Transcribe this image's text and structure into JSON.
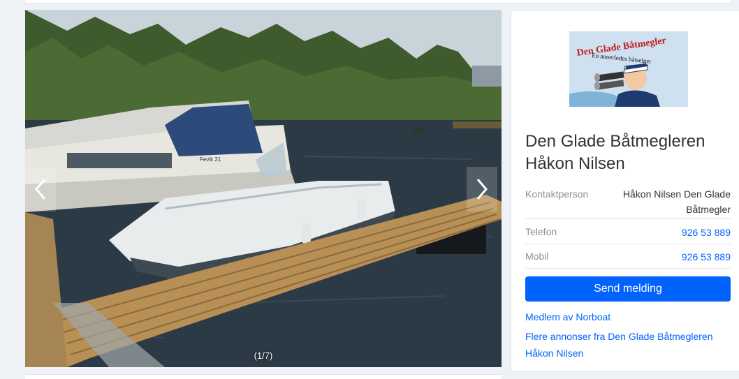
{
  "gallery": {
    "counter": "(1/7)",
    "prev_icon": "chevron-left-icon",
    "next_icon": "chevron-right-icon"
  },
  "boat_hull_text": "Fevik 21",
  "dealer": {
    "logo": {
      "title": "Den Glade Båtmegler",
      "tagline": "En annerledes båtselger"
    },
    "name": "Den Glade Båtmegleren Håkon Nilsen",
    "contact_label": "Kontaktperson",
    "contact_value": "Håkon Nilsen Den Glade Båtmegler",
    "phone_label": "Telefon",
    "phone_value": "926 53 889",
    "mobile_label": "Mobil",
    "mobile_value": "926 53 889",
    "send_button": "Send melding",
    "member_link": "Medlem av Norboat",
    "more_ads_link": "Flere annonser fra Den Glade Båtmegleren Håkon Nilsen"
  },
  "colors": {
    "accent": "#0063fb",
    "background": "#eef2f6"
  }
}
